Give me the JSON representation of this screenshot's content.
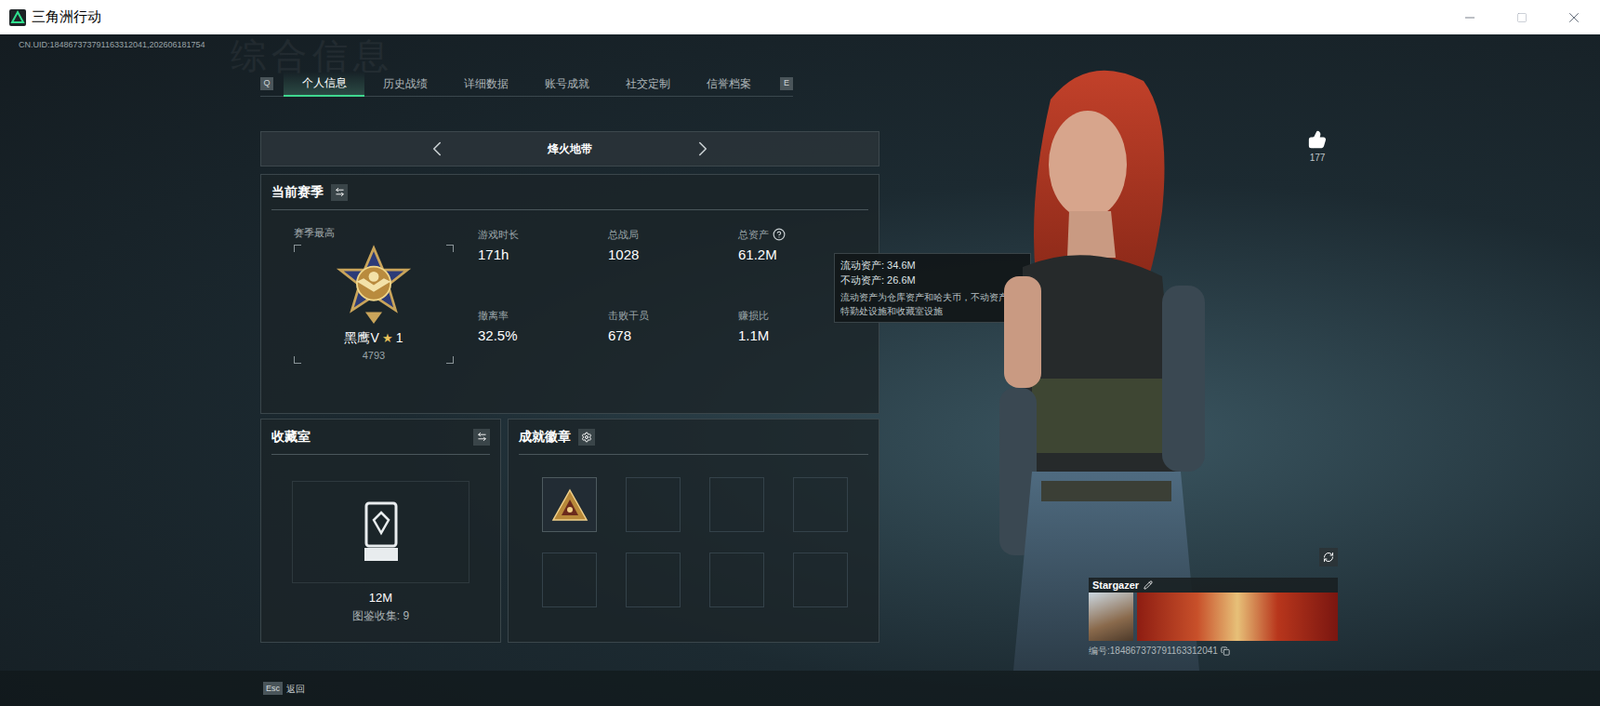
{
  "window": {
    "title": "三角洲行动"
  },
  "uid": "CN.UID:184867373791163312041,202606181754",
  "watermark": "综合信息",
  "tabs": {
    "prev_key": "Q",
    "next_key": "E",
    "items": [
      {
        "label": "个人信息",
        "selected": true
      },
      {
        "label": "历史战绩",
        "selected": false
      },
      {
        "label": "详细数据",
        "selected": false
      },
      {
        "label": "账号成就",
        "selected": false
      },
      {
        "label": "社交定制",
        "selected": false
      },
      {
        "label": "信誉档案",
        "selected": false
      }
    ]
  },
  "mode": {
    "label": "烽火地带"
  },
  "season": {
    "title": "当前赛季",
    "best_label": "赛季最高",
    "rank": "黑鹰V",
    "star": "★",
    "star_count": "1",
    "score": "4793",
    "stats": [
      {
        "label": "游戏时长",
        "value": "171h",
        "help": false
      },
      {
        "label": "总战局",
        "value": "1028",
        "help": false
      },
      {
        "label": "总资产",
        "value": "61.2M",
        "help": true
      },
      {
        "label": "撤离率",
        "value": "32.5%",
        "help": false
      },
      {
        "label": "击败干员",
        "value": "678",
        "help": false
      },
      {
        "label": "赚损比",
        "value": "1.1M",
        "help": false
      }
    ]
  },
  "tooltip": {
    "lines": [
      "流动资产: 34.6M",
      "不动资产: 26.6M"
    ],
    "note": "流动资产为仓库资产和哈夫币，不动资产为特勤处设施和收藏室设施"
  },
  "collection": {
    "title": "收藏室",
    "value": "12M",
    "caption": "图鉴收集: 9"
  },
  "badges": {
    "title": "成就徽章",
    "slots": [
      {
        "filled": true
      },
      {
        "filled": false
      },
      {
        "filled": false
      },
      {
        "filled": false
      },
      {
        "filled": false
      },
      {
        "filled": false
      },
      {
        "filled": false
      },
      {
        "filled": false
      }
    ]
  },
  "likes": "177",
  "player": {
    "name": "Stargazer",
    "id": "编号:184867373791163312041"
  },
  "footer": {
    "key": "Esc",
    "label": "返回"
  }
}
